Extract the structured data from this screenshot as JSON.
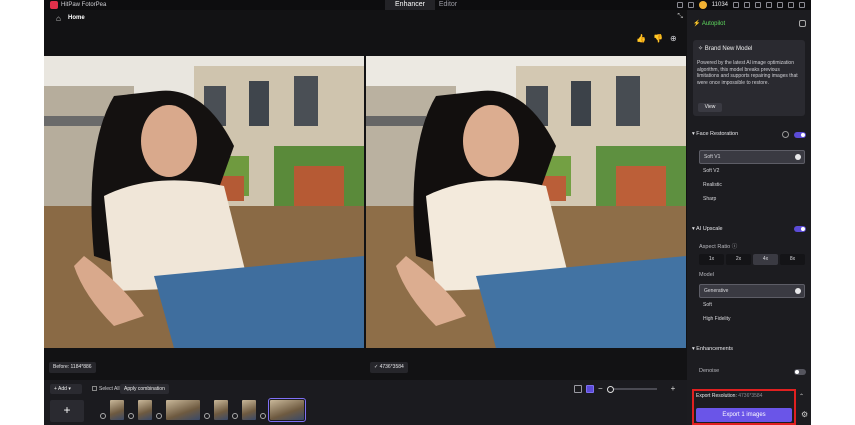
{
  "titlebar": {
    "app_name": "HitPaw FotorPea",
    "tabs": [
      "Enhancer",
      "Editor"
    ],
    "coins": "11034"
  },
  "nav": {
    "home": "Home",
    "home_icon": "home-icon"
  },
  "preview": {
    "before_badge": "Before: 1184*886",
    "after_badge": "4736*3584",
    "after_check_icon": "check-icon"
  },
  "bottom": {
    "add_label": "Add",
    "select_all": "Select All",
    "apply_combination": "Apply combination"
  },
  "panel": {
    "autopilot": "Autopilot",
    "model_card": {
      "title": "Brand New Model",
      "text": "Powered by the latest AI image optimization algorithm, this model breaks previous limitations and supports repairing images that were once impossible to restore.",
      "view": "View"
    },
    "face_restoration": {
      "title": "Face Restoration",
      "options": [
        "Soft V1",
        "Soft V2",
        "Realistic",
        "Sharp"
      ],
      "selected": "Soft V1",
      "enabled": true
    },
    "ai_upscale": {
      "title": "AI Upscale",
      "enabled": true,
      "aspect_ratio_label": "Aspect Ratio",
      "ratios": [
        "1x",
        "2x",
        "4x",
        "8x"
      ],
      "selected_ratio": "4x",
      "model_label": "Model",
      "models": [
        "Generative",
        "Soft",
        "High Fidelity"
      ],
      "selected_model": "Generative"
    },
    "enhancements": {
      "title": "Enhancements",
      "denoise": "Denoise",
      "denoise_enabled": false
    },
    "export": {
      "resolution_label": "Export Resolution:",
      "resolution_value": "4736*3584",
      "button": "Export 1 images"
    }
  },
  "colors": {
    "accent": "#6a55e8",
    "highlight_border": "#e02020",
    "autopilot_green": "#5fdc5f"
  }
}
